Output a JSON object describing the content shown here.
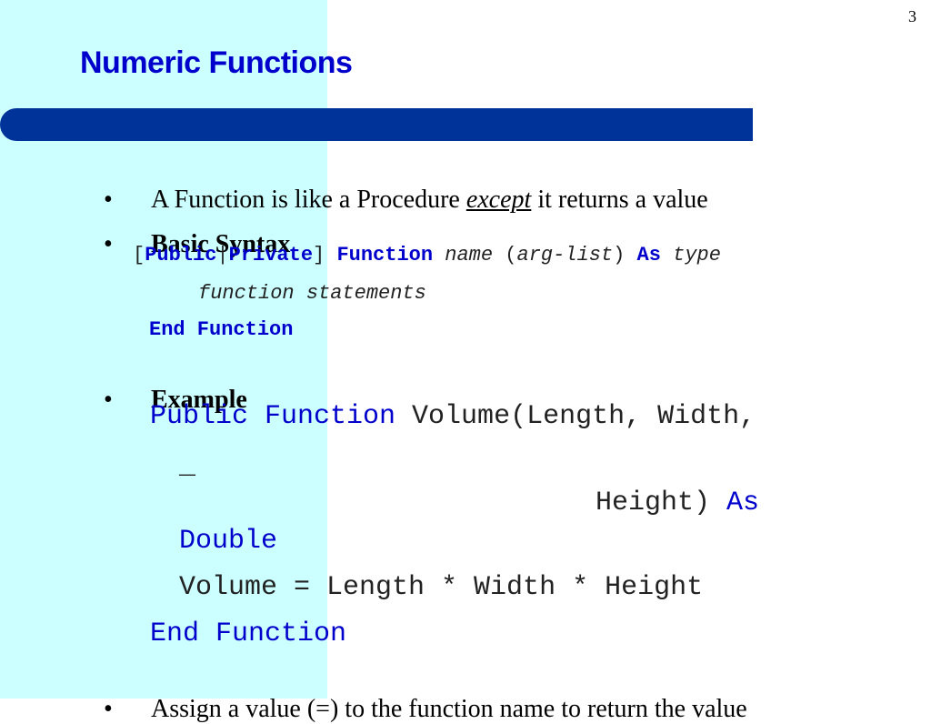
{
  "slide": {
    "page_number": "3",
    "title": "Numeric Functions",
    "bullet_char": "•"
  },
  "bullets": {
    "b1": {
      "before": "A Function is like a Procedure ",
      "emphasis": "except",
      "after": " it returns a value"
    },
    "b2": {
      "label": "Basic Syntax"
    },
    "b3": {
      "label": "Example"
    },
    "b4": {
      "text": "Assign a value (=) to the function name to return the value"
    }
  },
  "syntax": {
    "open_bracket": "[",
    "public": "Public",
    "pipe": "|",
    "private": "Private",
    "close_bracket": "] ",
    "function_kw": "Function",
    "name": "name",
    "open_paren": " (",
    "arg_list": "arg-list",
    "close_paren": ") ",
    "as_kw": "As",
    "type": "type",
    "statements": "function statements",
    "end_function": "End Function"
  },
  "example": {
    "decl_keywords": "Public Function",
    "decl_rest": " Volume(Length, Width,",
    "continuation": "_",
    "height_text": "Height) ",
    "as_kw": "As",
    "double_kw": "Double",
    "body": "Volume = Length * Width * Height",
    "end_function": "End Function"
  },
  "colors": {
    "title": "#0000cc",
    "side_panel": "#ccffff",
    "title_bar": "#003399",
    "keyword": "#0000cc"
  }
}
